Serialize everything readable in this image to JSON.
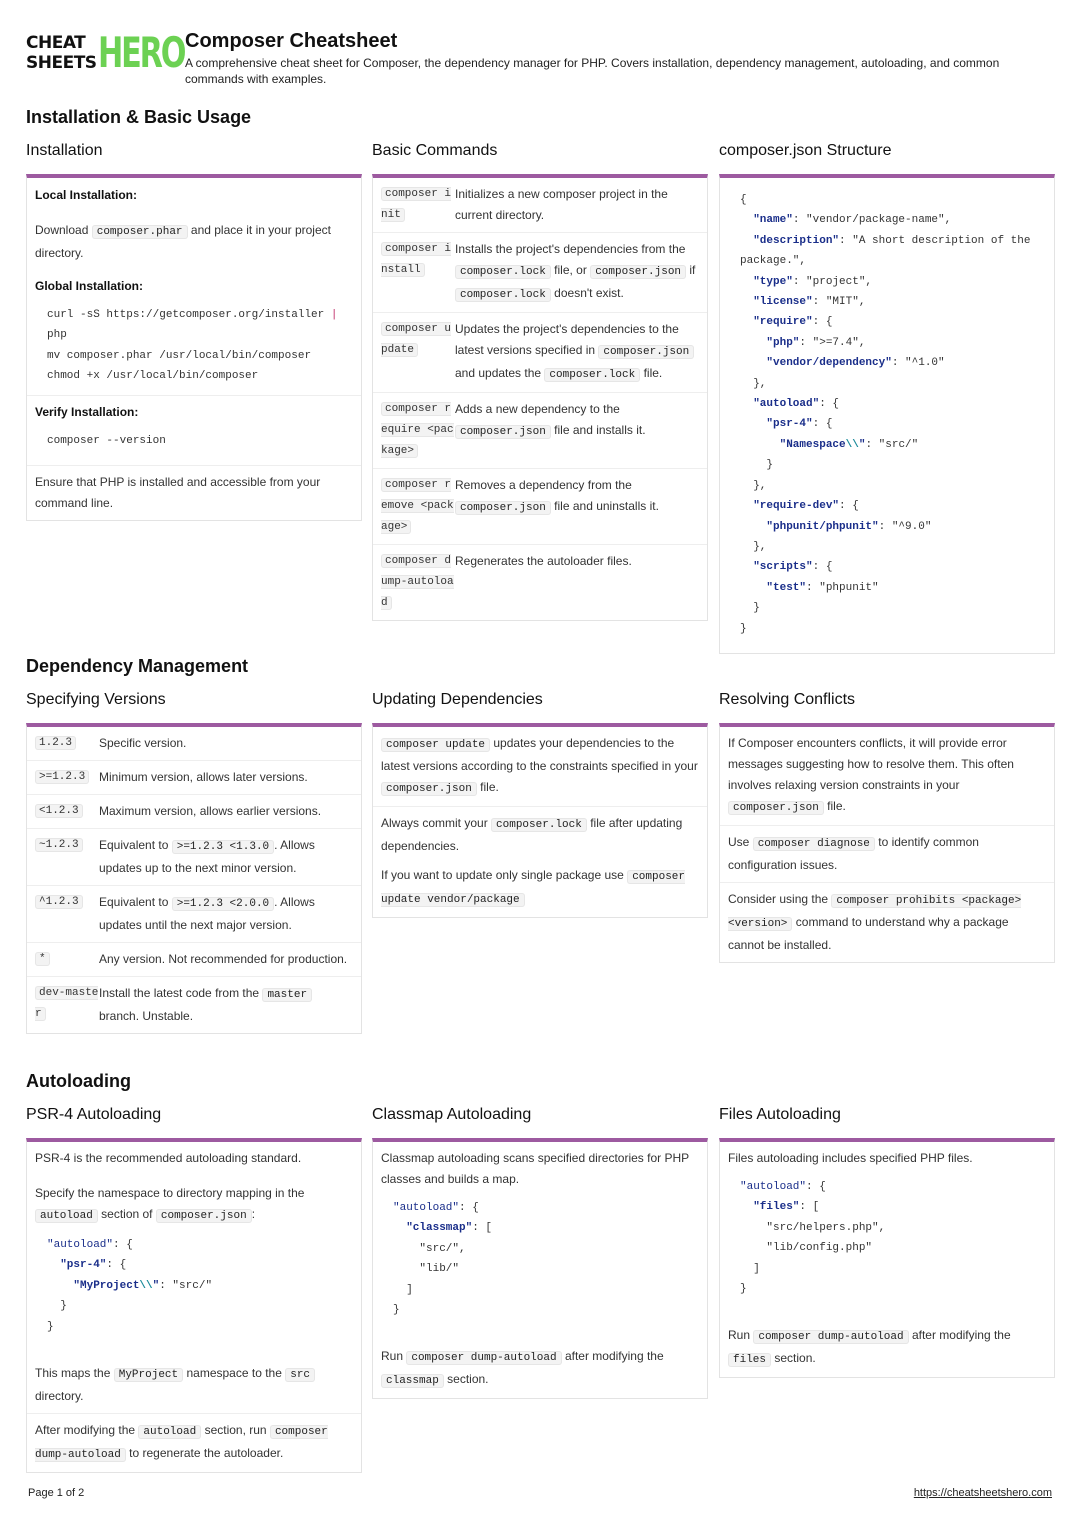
{
  "header": {
    "logo_top": "CHEAT",
    "logo_bottom": "SHEETS",
    "logo_hero": "HERO",
    "title": "Composer Cheatsheet",
    "description": "A comprehensive cheat sheet for Composer, the dependency manager for PHP. Covers installation, dependency management, autoloading, and common commands with examples."
  },
  "sections": {
    "install": "Installation & Basic Usage",
    "deps": "Dependency Management",
    "autoload": "Autoloading"
  },
  "installation": {
    "title": "Installation",
    "local_label": "Local Installation:",
    "local_pre": "Download",
    "local_code": "composer.phar",
    "local_post": "and place it in your project directory.",
    "global_label": "Global Installation:",
    "global_line1": "curl -sS https://getcomposer.org/installer ",
    "global_pipe": "|",
    "global_line2": "php\nmv composer.phar /usr/local/bin/composer\nchmod +x /usr/local/bin/composer",
    "verify_label": "Verify Installation:",
    "verify_code": "composer --version",
    "note": "Ensure that PHP is installed and accessible from your command line."
  },
  "basic_commands": {
    "title": "Basic Commands",
    "init": {
      "cmd": "composer init",
      "desc": "Initializes a new composer project in the current directory."
    },
    "install": {
      "cmd": "composer install",
      "d1": "Installs the project's dependencies from the",
      "c1": "composer.lock",
      "d2": "file, or",
      "c2": "composer.json",
      "d3": "if",
      "c3": "composer.lock",
      "d4": "doesn't exist."
    },
    "update": {
      "cmd": "composer update",
      "d1": "Updates the project's dependencies to the latest versions specified in",
      "c1": "composer.json",
      "d2": "and updates the",
      "c2": "composer.lock",
      "d3": "file."
    },
    "require": {
      "cmd": "composer require <package>",
      "d1": "Adds a new dependency to the",
      "c1": "composer.json",
      "d2": "file and installs it."
    },
    "remove": {
      "cmd": "composer remove <package>",
      "d1": "Removes a dependency from the",
      "c1": "composer.json",
      "d2": "file and uninstalls it."
    },
    "dump": {
      "cmd": "composer dump-autoload",
      "desc": "Regenerates the autoloader files."
    }
  },
  "composer_json": {
    "title": "composer.json Structure"
  },
  "versions": {
    "title": "Specifying Versions",
    "rows": [
      {
        "k": "1.2.3",
        "d": "Specific version."
      },
      {
        "k": ">=1.2.3",
        "d": "Minimum version, allows later versions."
      },
      {
        "k": "<1.2.3",
        "d": "Maximum version, allows earlier versions."
      },
      {
        "k": "~1.2.3",
        "d1": "Equivalent to",
        "c": ">=1.2.3 <1.3.0",
        "d2": ". Allows updates up to the next minor version."
      },
      {
        "k": "^1.2.3",
        "d1": "Equivalent to",
        "c": ">=1.2.3 <2.0.0",
        "d2": ". Allows updates until the next major version."
      },
      {
        "k": "*",
        "d": "Any version. Not recommended for production."
      },
      {
        "k": "dev-master",
        "d1": "Install the latest code from the",
        "c": "master",
        "d2": "branch. Unstable."
      }
    ]
  },
  "updating": {
    "title": "Updating Dependencies",
    "r1_c1": "composer update",
    "r1_d1": "updates your dependencies to the latest versions according to the constraints specified in your",
    "r1_c2": "composer.json",
    "r1_d2": "file.",
    "r2_d1": "Always commit your",
    "r2_c1": "composer.lock",
    "r2_d2": "file after updating dependencies.",
    "r2_d3": "If you want to update only single package use",
    "r2_c2": "composer update vendor/package"
  },
  "conflicts": {
    "title": "Resolving Conflicts",
    "r1_d1": "If Composer encounters conflicts, it will provide error messages suggesting how to resolve them. This often involves relaxing version constraints in your",
    "r1_c1": "composer.json",
    "r1_d2": "file.",
    "r2_d1": "Use",
    "r2_c1": "composer diagnose",
    "r2_d2": "to identify common configuration issues.",
    "r3_d1": "Consider using the",
    "r3_c1": "composer prohibits <package> <version>",
    "r3_d2": "command to understand why a package cannot be installed."
  },
  "psr4": {
    "title": "PSR-4 Autoloading",
    "intro": "PSR-4 is the recommended autoloading standard.",
    "spec_d1": "Specify the namespace to directory mapping in the",
    "spec_c1": "autoload",
    "spec_d2": "section of",
    "spec_c2": "composer.json",
    "spec_d3": ":",
    "maps_d1": "This maps the",
    "maps_c1": "MyProject",
    "maps_d2": "namespace to the",
    "maps_c2": "src",
    "maps_d3": "directory.",
    "after_d1": "After modifying the",
    "after_c1": "autoload",
    "after_d2": "section, run",
    "after_c2": "composer dump-autoload",
    "after_d3": "to regenerate the autoloader."
  },
  "classmap": {
    "title": "Classmap Autoloading",
    "intro": "Classmap autoloading scans specified directories for PHP classes and builds a map.",
    "run_d1": "Run",
    "run_c1": "composer dump-autoload",
    "run_d2": "after modifying the",
    "run_c2": "classmap",
    "run_d3": "section."
  },
  "files": {
    "title": "Files Autoloading",
    "intro": "Files autoloading includes specified PHP files.",
    "run_d1": "Run",
    "run_c1": "composer dump-autoload",
    "run_d2": "after modifying the",
    "run_c2": "files",
    "run_d3": "section."
  },
  "footer": {
    "page": "Page 1 of 2",
    "url": "https://cheatsheetshero.com"
  }
}
